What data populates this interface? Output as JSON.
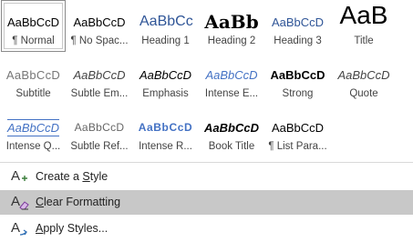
{
  "styles": [
    {
      "preview": "AaBbCcD",
      "name": "¶ Normal",
      "cls": "p-normal",
      "selected": true
    },
    {
      "preview": "AaBbCcD",
      "name": "¶ No Spac...",
      "cls": "p-nospace"
    },
    {
      "preview": "AaBbCc",
      "name": "Heading 1",
      "cls": "p-h1"
    },
    {
      "preview": "AaBb",
      "name": "Heading 2",
      "cls": "p-h2"
    },
    {
      "preview": "AaBbCcD",
      "name": "Heading 3",
      "cls": "p-h3"
    },
    {
      "preview": "AaB",
      "name": "Title",
      "cls": "p-title"
    },
    {
      "preview": "AaBbCcD",
      "name": "Subtitle",
      "cls": "p-subtitle"
    },
    {
      "preview": "AaBbCcD",
      "name": "Subtle Em...",
      "cls": "p-subtleemph"
    },
    {
      "preview": "AaBbCcD",
      "name": "Emphasis",
      "cls": "p-emph"
    },
    {
      "preview": "AaBbCcD",
      "name": "Intense E...",
      "cls": "p-intenseemph"
    },
    {
      "preview": "AaBbCcD",
      "name": "Strong",
      "cls": "p-strong"
    },
    {
      "preview": "AaBbCcD",
      "name": "Quote",
      "cls": "p-quote"
    },
    {
      "preview": "AaBbCcD",
      "name": "Intense Q...",
      "cls": "p-intensequote"
    },
    {
      "preview": "AaBbCcD",
      "name": "Subtle Ref...",
      "cls": "p-subtleref"
    },
    {
      "preview": "AaBbCcD",
      "name": "Intense R...",
      "cls": "p-intenseref"
    },
    {
      "preview": "AaBbCcD",
      "name": "Book Title",
      "cls": "p-booktitle"
    },
    {
      "preview": "AaBbCcD",
      "name": "¶ List Para...",
      "cls": "p-listpara"
    }
  ],
  "menu": {
    "create_style": {
      "before": "Create a ",
      "access": "S",
      "after": "tyle"
    },
    "clear_formatting": {
      "before": "",
      "access": "C",
      "after": "lear Formatting"
    },
    "apply_styles": {
      "before": "",
      "access": "A",
      "after": "pply Styles..."
    }
  },
  "colors": {
    "accent_blue": "#4472c4",
    "heading_blue": "#2f5597",
    "hover_gray": "#c8c8c8",
    "icon_purple": "#7a3a9a"
  }
}
